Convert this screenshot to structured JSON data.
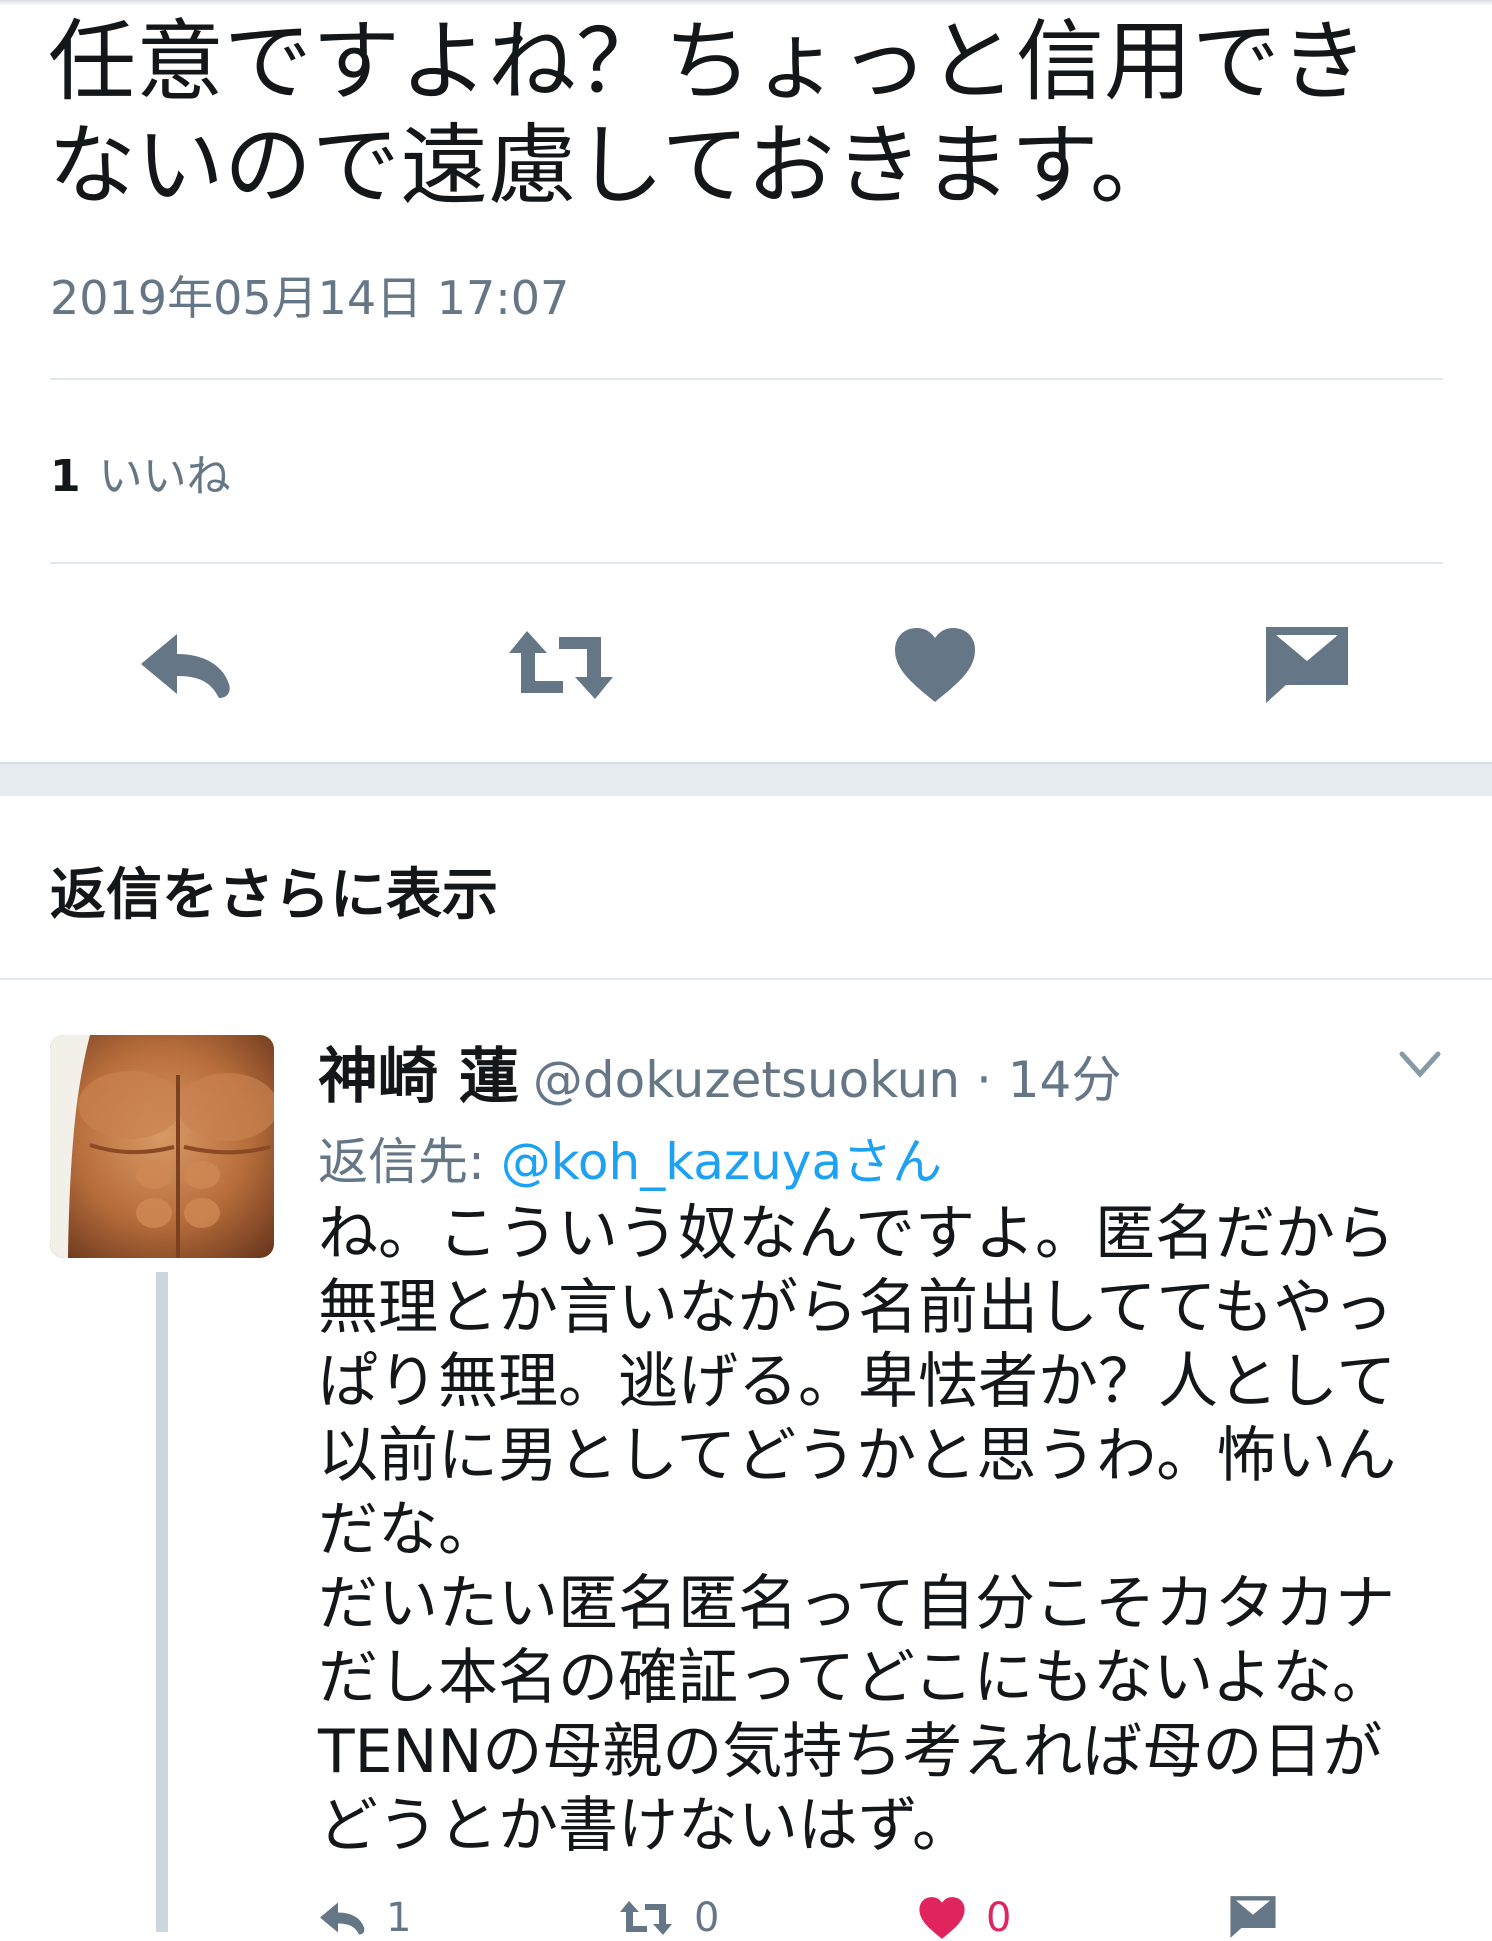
{
  "tweet": {
    "text_lines": [
      "任意ですよね？ちょっと信用でき",
      "ないので遠慮しておきます。"
    ],
    "timestamp": "2019年05月14日 17:07",
    "likes_count": "1",
    "likes_label": "いいね"
  },
  "actions": [
    "reply-icon",
    "retweet-icon",
    "heart-icon",
    "message-icon"
  ],
  "more_replies_label": "返信をさらに表示",
  "reply": {
    "name": "神崎 蓮",
    "handle_time": "@dokuzetsuokun · 14分",
    "reply_to_label": "返信先: ",
    "reply_to_mention": "@koh_kazuyaさん",
    "text_lines": [
      "ね。こういう奴なんですよ。匿名だから",
      "無理とか言いながら名前出しててもやっ",
      "ぱり無理。逃げる。卑怯者か？人として",
      "以前に男としてどうかと思うわ。怖いん",
      "だな。",
      "だいたい匿名匿名って自分こそカタカナ",
      "だし本名の確証ってどこにもないよな。",
      "TENNの母親の気持ち考えれば母の日が",
      "どうとか書けないはず。"
    ],
    "reply_count": "1",
    "retweet_count": "0",
    "like_count": "0"
  },
  "colors": {
    "accent": "#1da1f2",
    "muted": "#657786",
    "like": "#e0245e"
  }
}
